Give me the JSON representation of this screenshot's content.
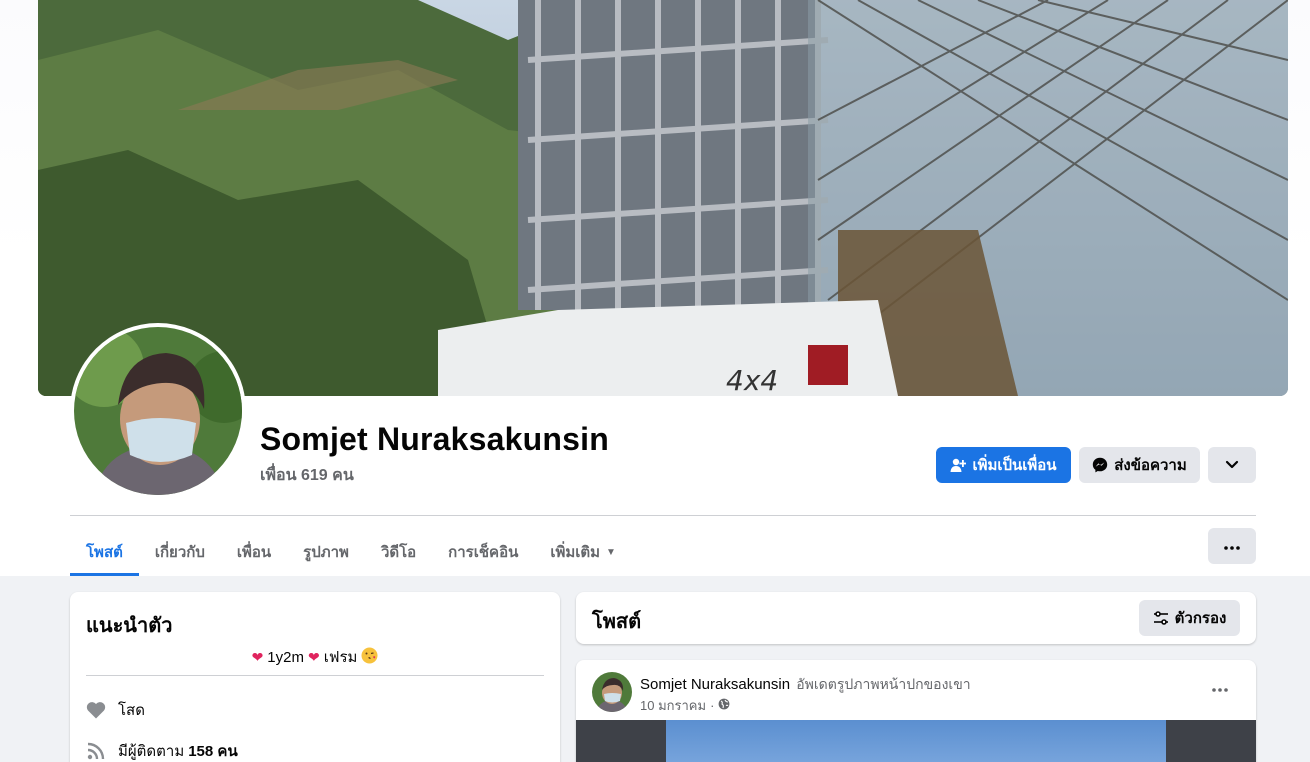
{
  "profile": {
    "name": "Somjet Nuraksakunsin",
    "friends": "เพื่อน 619 คน"
  },
  "actions": {
    "add_friend": "เพิ่มเป็นเพื่อน",
    "message": "ส่งข้อความ"
  },
  "tabs": [
    {
      "label": "โพสต์",
      "active": true
    },
    {
      "label": "เกี่ยวกับ"
    },
    {
      "label": "เพื่อน"
    },
    {
      "label": "รูปภาพ"
    },
    {
      "label": "วิดีโอ"
    },
    {
      "label": "การเช็คอิน"
    },
    {
      "label": "เพิ่มเติม"
    }
  ],
  "intro": {
    "title": "แนะนำตัว",
    "bio_mid": "1y2m",
    "bio_end": "เฟรม",
    "relationship": "โสด",
    "followers_prefix": "มีผู้ติดตาม",
    "followers_count": "158 คน"
  },
  "posts": {
    "title": "โพสต์",
    "filter": "ตัวกรอง",
    "items": [
      {
        "author": "Somjet Nuraksakunsin",
        "action": "อัพเดตรูปภาพหน้าปกของเขา",
        "date": "10 มกราคม",
        "sep": "·"
      }
    ]
  },
  "colors": {
    "accent": "#1b74e4",
    "secondary_btn": "#e4e6eb",
    "page_bg": "#f0f2f5",
    "muted_text": "#65676b",
    "heart": "#e0245e"
  },
  "icons": [
    "add-friend-icon",
    "messenger-icon",
    "chevron-down-icon",
    "more-dots-icon",
    "filter-icon",
    "heart-icon",
    "rss-icon",
    "globe-icon",
    "caret-down-icon"
  ]
}
